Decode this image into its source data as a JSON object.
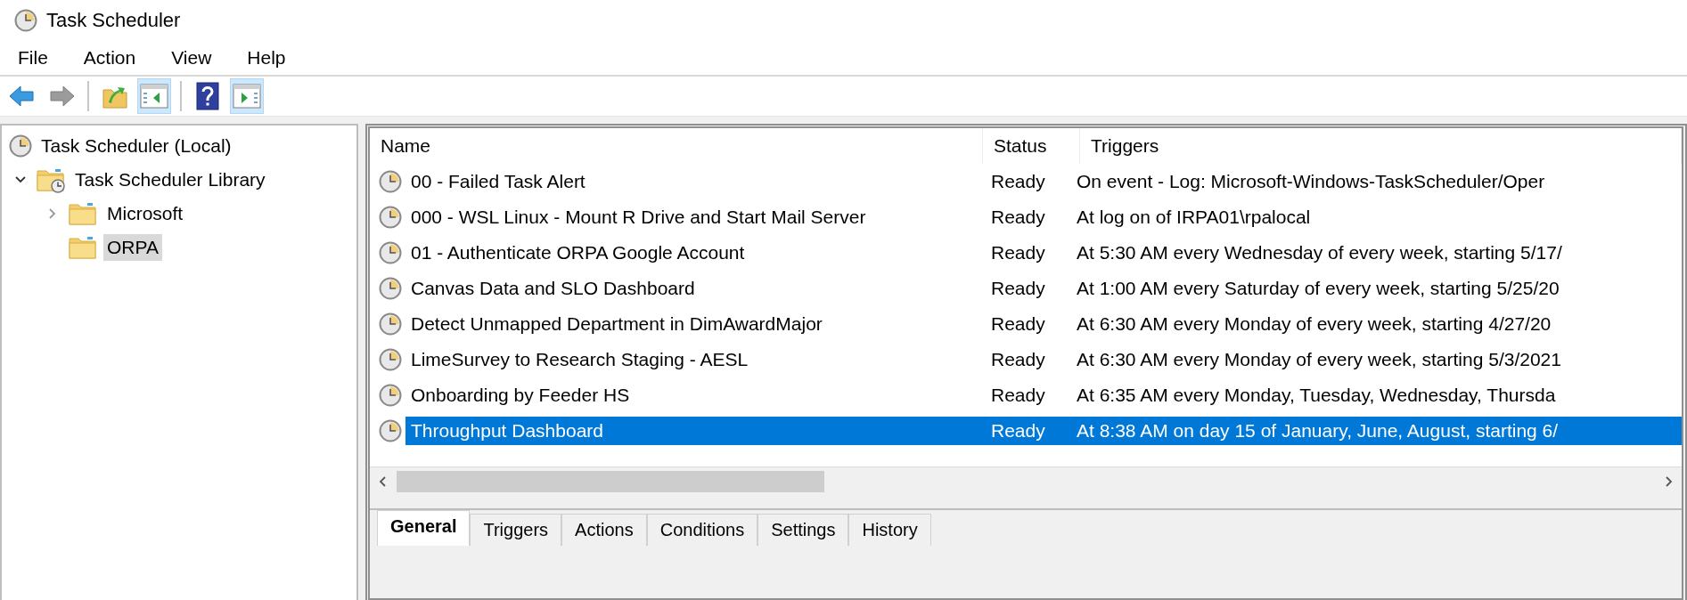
{
  "window": {
    "title": "Task Scheduler"
  },
  "menu": [
    "File",
    "Action",
    "View",
    "Help"
  ],
  "toolbar": [
    [
      {
        "kind": "back",
        "disabled": false,
        "pressed": false
      },
      {
        "kind": "forward",
        "disabled": true,
        "pressed": false
      }
    ],
    [
      {
        "kind": "up",
        "disabled": false,
        "pressed": false
      },
      {
        "kind": "console-tree",
        "disabled": false,
        "pressed": true
      }
    ],
    [
      {
        "kind": "help",
        "disabled": false,
        "pressed": false
      },
      {
        "kind": "action-pane",
        "disabled": false,
        "pressed": true
      }
    ]
  ],
  "tree": [
    {
      "label": "Task Scheduler (Local)",
      "kind": "root",
      "selected": false,
      "children": [
        {
          "label": "Task Scheduler Library",
          "kind": "library",
          "expandable": true,
          "expanded": true,
          "selected": false,
          "children": [
            {
              "label": "Microsoft",
              "kind": "folder",
              "expandable": true,
              "expanded": false,
              "selected": false
            },
            {
              "label": "ORPA",
              "kind": "folder",
              "expandable": false,
              "selected": true
            }
          ]
        }
      ]
    }
  ],
  "table": {
    "columns": [
      "Name",
      "Status",
      "Triggers"
    ],
    "rows": [
      {
        "name": "00 - Failed Task Alert",
        "status": "Ready",
        "triggers": "On event - Log: Microsoft-Windows-TaskScheduler/Oper",
        "selected": false
      },
      {
        "name": "000 - WSL Linux - Mount R Drive and Start Mail Server",
        "status": "Ready",
        "triggers": "At log on of IRPA01\\rpalocal",
        "selected": false
      },
      {
        "name": "01 - Authenticate ORPA Google Account",
        "status": "Ready",
        "triggers": "At 5:30 AM every Wednesday of every week, starting 5/17/",
        "selected": false
      },
      {
        "name": "Canvas Data and SLO Dashboard",
        "status": "Ready",
        "triggers": "At 1:00 AM every Saturday of every week, starting 5/25/20",
        "selected": false
      },
      {
        "name": "Detect Unmapped Department in DimAwardMajor",
        "status": "Ready",
        "triggers": "At 6:30 AM every Monday of every week, starting 4/27/20",
        "selected": false
      },
      {
        "name": "LimeSurvey to Research Staging - AESL",
        "status": "Ready",
        "triggers": "At 6:30 AM every Monday of every week, starting 5/3/2021",
        "selected": false
      },
      {
        "name": "Onboarding by Feeder HS",
        "status": "Ready",
        "triggers": "At 6:35 AM every Monday, Tuesday, Wednesday, Thursda",
        "selected": false
      },
      {
        "name": "Throughput Dashboard",
        "status": "Ready",
        "triggers": "At 8:38 AM  on day 15 of January, June, August, starting 6/",
        "selected": true
      }
    ]
  },
  "detail_tabs": [
    {
      "label": "General",
      "selected": true
    },
    {
      "label": "Triggers",
      "selected": false
    },
    {
      "label": "Actions",
      "selected": false
    },
    {
      "label": "Conditions",
      "selected": false
    },
    {
      "label": "Settings",
      "selected": false
    },
    {
      "label": "History",
      "selected": false
    }
  ]
}
